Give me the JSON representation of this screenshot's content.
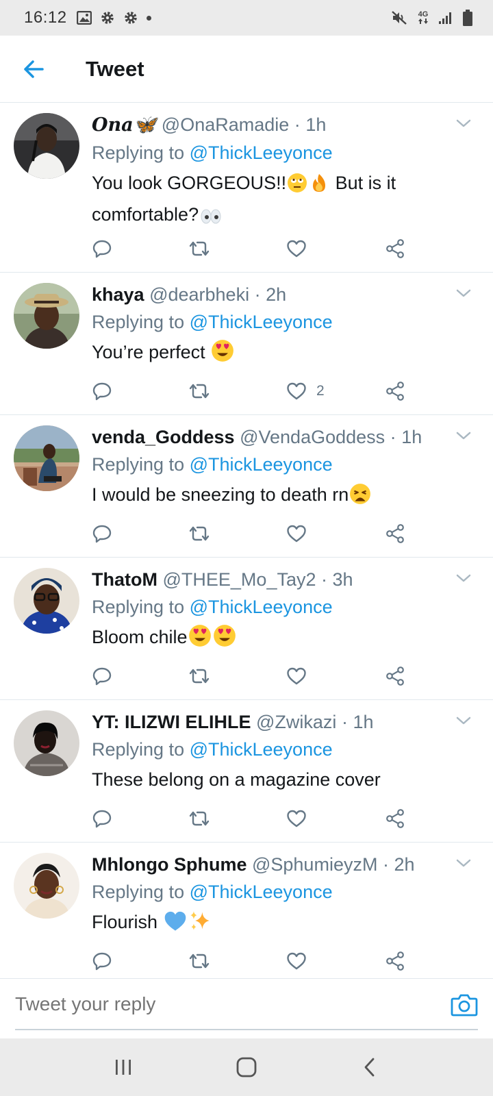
{
  "status_bar": {
    "time": "16:12",
    "network": "4G"
  },
  "header": {
    "title": "Tweet"
  },
  "colors": {
    "accent": "#1b95e0",
    "text": "#14171a",
    "muted": "#657786"
  },
  "tweets": [
    {
      "name": "Ona🦋",
      "handle": "@OnaRamadie",
      "dot": "·",
      "time": "1h",
      "replying_prefix": "Replying to ",
      "replying_to": "@ThickLeeyonce",
      "text_1": "You look GORGEOUS!!",
      "text_2": " But is it comfortable?",
      "likes": ""
    },
    {
      "name": "khaya",
      "handle": "@dearbheki",
      "dot": "·",
      "time": "2h",
      "replying_prefix": "Replying to ",
      "replying_to": "@ThickLeeyonce",
      "text_1": "You’re perfect ",
      "likes": "2"
    },
    {
      "name": "venda_Goddess",
      "handle": "@VendaGoddess",
      "dot": "·",
      "time": "1h",
      "replying_prefix": "Replying to ",
      "replying_to": "@ThickLeeyonce",
      "text_1": "I would be sneezing to death rn",
      "likes": ""
    },
    {
      "name": "ThatoM",
      "handle": "@THEE_Mo_Tay2",
      "dot": "·",
      "time": "3h",
      "replying_prefix": "Replying to ",
      "replying_to": "@ThickLeeyonce",
      "text_1": "Bloom chile",
      "likes": ""
    },
    {
      "name": "YT: ILIZWI ELIHLE",
      "handle": "@Zwikazi",
      "dot": "·",
      "time": "1h",
      "replying_prefix": "Replying to ",
      "replying_to": "@ThickLeeyonce",
      "text_1": "These belong on a magazine cover",
      "likes": ""
    },
    {
      "name": "Mhlongo Sphume",
      "handle": "@SphumieyzM",
      "dot": "·",
      "time": "2h",
      "replying_prefix": "Replying to ",
      "replying_to": "@ThickLeeyonce",
      "text_1": "Flourish ",
      "likes": ""
    }
  ],
  "reply_bar": {
    "placeholder": "Tweet your reply"
  }
}
